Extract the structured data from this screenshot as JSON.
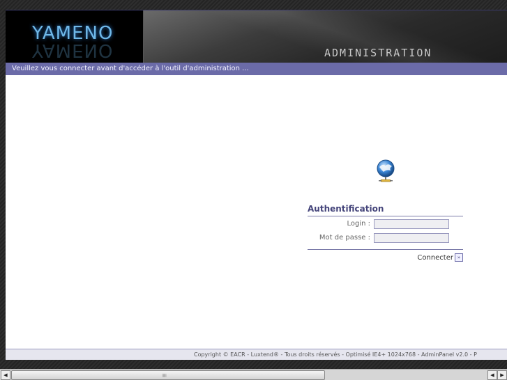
{
  "header": {
    "logo_text": "YAMENO",
    "title": "ADMINISTRATION"
  },
  "info_bar": {
    "message": "Veuillez vous connecter avant d'accéder à l'outil d'administration ..."
  },
  "auth": {
    "title": "Authentification",
    "login_label": "Login :",
    "login_value": "",
    "password_label": "Mot de passe :",
    "password_value": "",
    "connect_label": "Connecter",
    "connect_arrow": "»"
  },
  "footer": {
    "copyright": "Copyright © EACR - Luxtend® - Tous droits réservés - Optimisé IE4+ 1024x768 - AdminPanel v2.0 - P"
  },
  "icons": {
    "login": "globe-network-icon",
    "scroll_left": "scroll-left-arrow-icon",
    "scroll_right": "scroll-right-arrow-icon"
  },
  "scrollbar": {
    "left_arrow": "◀",
    "right_arrow": "▶",
    "grip": "⁞⁞⁞⁞⁞"
  },
  "colors": {
    "accent": "#6b6ba8",
    "header_bg": "#111111",
    "logo_color": "#6fb8e8"
  }
}
